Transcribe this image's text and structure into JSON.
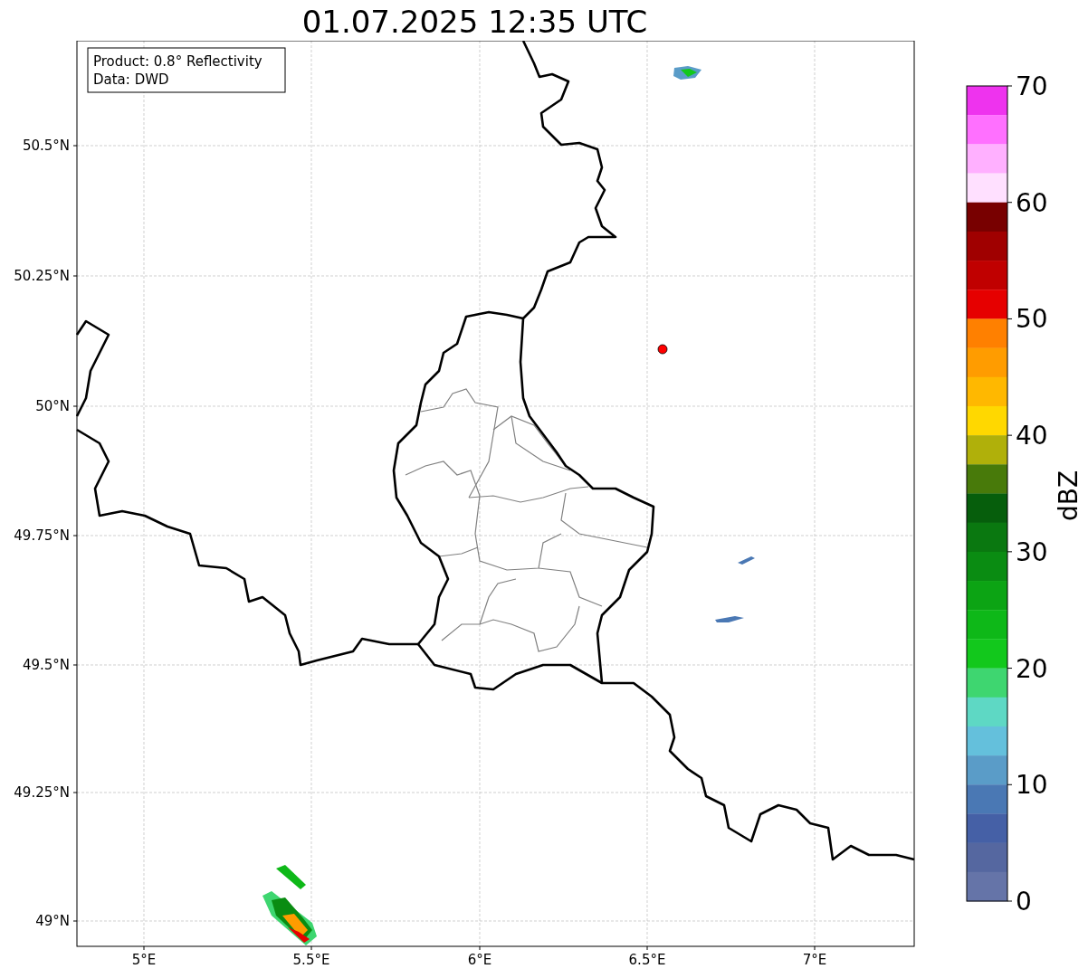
{
  "title": "01.07.2025 12:35 UTC",
  "info_box": {
    "lines": [
      "Product: 0.8° Reflectivity",
      "Data: DWD"
    ]
  },
  "map": {
    "lat_ticks": [
      "50.5°N",
      "50.25°N",
      "50°N",
      "49.75°N",
      "49.5°N",
      "49.25°N",
      "49°N"
    ],
    "lon_ticks": [
      "5°E",
      "5.5°E",
      "6°E",
      "6.5°E",
      "7°E"
    ]
  },
  "colorbar": {
    "label": "dBZ",
    "ticks": [
      "70",
      "60",
      "50",
      "40",
      "30",
      "20",
      "10",
      "0"
    ],
    "segments": [
      {
        "color": "#ee33ee"
      },
      {
        "color": "#ff70ff"
      },
      {
        "color": "#ffb0ff"
      },
      {
        "color": "#ffe0ff"
      },
      {
        "color": "#780000"
      },
      {
        "color": "#a00000"
      },
      {
        "color": "#c00000"
      },
      {
        "color": "#e60000"
      },
      {
        "color": "#ff8000"
      },
      {
        "color": "#ff9c00"
      },
      {
        "color": "#ffb800"
      },
      {
        "color": "#ffd800"
      },
      {
        "color": "#b0b00a"
      },
      {
        "color": "#487a0a"
      },
      {
        "color": "#065e0c"
      },
      {
        "color": "#0a7810"
      },
      {
        "color": "#0a8c12"
      },
      {
        "color": "#0ca414"
      },
      {
        "color": "#0eb818"
      },
      {
        "color": "#12c81c"
      },
      {
        "color": "#3ed670"
      },
      {
        "color": "#5ed8c4"
      },
      {
        "color": "#64c0dc"
      },
      {
        "color": "#5a9cc8"
      },
      {
        "color": "#4a78b4"
      },
      {
        "color": "#4560a6"
      },
      {
        "color": "#5567a0"
      },
      {
        "color": "#6574a8"
      }
    ]
  }
}
